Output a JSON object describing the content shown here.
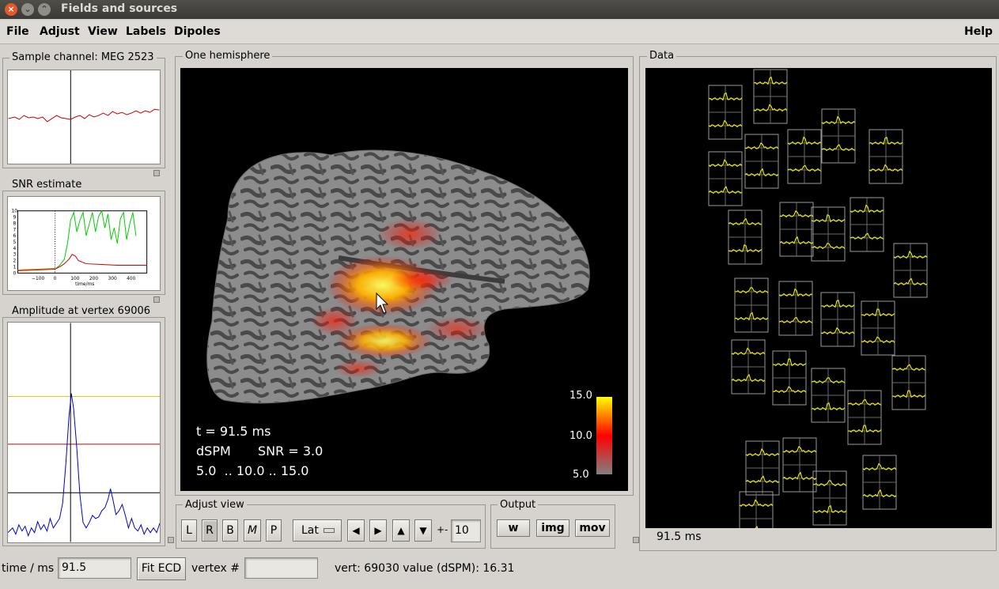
{
  "window": {
    "title": "Fields and sources"
  },
  "menu": {
    "items": [
      "File",
      "Adjust",
      "View",
      "Labels",
      "Dipoles"
    ],
    "help": "Help"
  },
  "panels": {
    "sample_channel": "Sample channel: MEG 2523",
    "snr_estimate": "SNR estimate",
    "amplitude": "Amplitude at vertex 69006",
    "hemisphere": "One hemisphere",
    "data": "Data"
  },
  "snr_axes": {
    "y_ticks": [
      "10",
      "9",
      "8",
      "7",
      "6",
      "5",
      "4",
      "3",
      "2",
      "1",
      "0"
    ],
    "x_ticks": [
      "−100",
      "0",
      "100",
      "200",
      "300",
      "400"
    ],
    "xlabel": "time/ms"
  },
  "overlay": {
    "time": "t = 91.5 ms",
    "method": "dSPM",
    "snr": "SNR = 3.0",
    "range": "5.0  .. 10.0 .. 15.0"
  },
  "colorbar": {
    "labels": [
      "15.0",
      "10.0",
      "5.0"
    ],
    "colors": [
      "#ffff00",
      "#ff0000",
      "#808080"
    ]
  },
  "adjust_view": {
    "title": "Adjust view",
    "buttons": [
      "L",
      "R",
      "B",
      "M",
      "P"
    ],
    "view_select": "Lat",
    "pm_label": "+-",
    "step_value": "10"
  },
  "output": {
    "title": "Output",
    "buttons": [
      "w",
      "img",
      "mov"
    ]
  },
  "data_time": "91.5 ms",
  "status": {
    "time_label": "time / ms :",
    "time_value": "91.5",
    "fit_button": "Fit ECD",
    "vertex_label": "vertex # :",
    "vertex_value": "",
    "info": "vert: 69030 value (dSPM): 16.31"
  },
  "colors": {
    "trace_red": "#cc0000",
    "trace_blue": "#0000cc",
    "trace_green": "#00cc00",
    "meg_yellow": "#ffff00"
  }
}
